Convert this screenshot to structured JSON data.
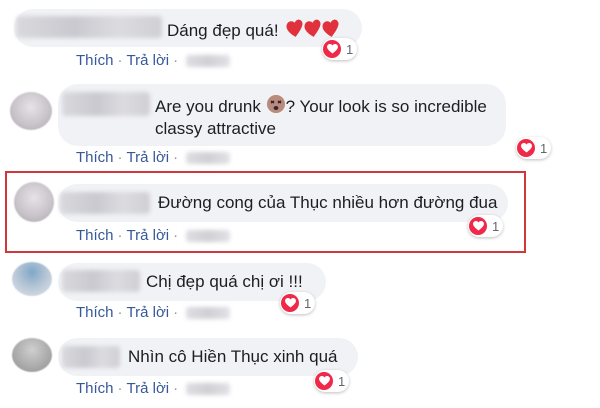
{
  "comments": [
    {
      "text": "Dáng đẹp quá!",
      "emoji": [
        "heart-emoji",
        "heart-emoji",
        "heart-emoji"
      ],
      "like_label": "Thích",
      "reply_label": "Trả lời",
      "reaction_count": "1"
    },
    {
      "text_line1_before": "Are you drunk",
      "text_line1_after": "? Your look is so incredible",
      "text_line2": "classy attractive",
      "emoji": [
        "dizzy-face-emoji"
      ],
      "like_label": "Thích",
      "reply_label": "Trả lời",
      "reaction_count": "1"
    },
    {
      "text": "Đường cong của Thục nhiều hơn đường đua",
      "like_label": "Thích",
      "reply_label": "Trả lời",
      "reaction_count": "1",
      "highlighted": true
    },
    {
      "text": "Chị đẹp quá chị ơi !!!",
      "like_label": "Thích",
      "reply_label": "Trả lời",
      "reaction_count": "1"
    },
    {
      "text": "Nhìn cô Hiền Thục xinh quá",
      "like_label": "Thích",
      "reply_label": "Trả lời",
      "reaction_count": "1"
    }
  ],
  "colors": {
    "link": "#365899",
    "bubble": "#f1f2f6",
    "reaction_heart": "#f0284a",
    "highlight_border": "#d0363a"
  }
}
